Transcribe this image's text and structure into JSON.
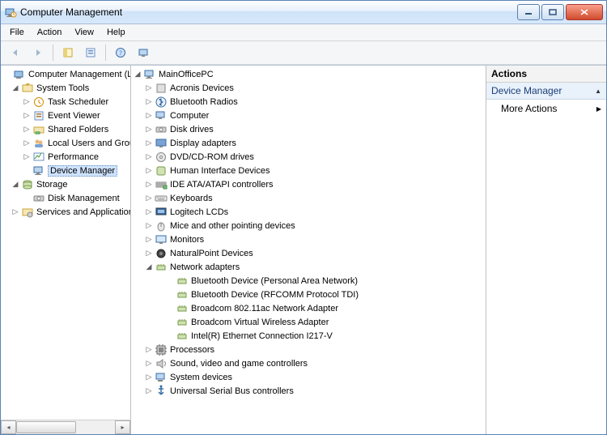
{
  "window": {
    "title": "Computer Management"
  },
  "menu": {
    "file": "File",
    "action": "Action",
    "view": "View",
    "help": "Help"
  },
  "leftTree": {
    "root": "Computer Management (Local",
    "systemTools": "System Tools",
    "taskScheduler": "Task Scheduler",
    "eventViewer": "Event Viewer",
    "sharedFolders": "Shared Folders",
    "localUsers": "Local Users and Groups",
    "performance": "Performance",
    "deviceManager": "Device Manager",
    "storage": "Storage",
    "diskManagement": "Disk Management",
    "servicesApps": "Services and Applications"
  },
  "devTree": {
    "root": "MainOfficePC",
    "cats": [
      "Acronis Devices",
      "Bluetooth Radios",
      "Computer",
      "Disk drives",
      "Display adapters",
      "DVD/CD-ROM drives",
      "Human Interface Devices",
      "IDE ATA/ATAPI controllers",
      "Keyboards",
      "Logitech LCDs",
      "Mice and other pointing devices",
      "Monitors",
      "NaturalPoint Devices",
      "Network adapters",
      "Processors",
      "Sound, video and game controllers",
      "System devices",
      "Universal Serial Bus controllers"
    ],
    "net": [
      "Bluetooth Device (Personal Area Network)",
      "Bluetooth Device (RFCOMM Protocol TDI)",
      "Broadcom 802.11ac Network Adapter",
      "Broadcom Virtual Wireless Adapter",
      "Intel(R) Ethernet Connection I217-V"
    ]
  },
  "actions": {
    "header": "Actions",
    "section": "Device Manager",
    "more": "More Actions"
  }
}
